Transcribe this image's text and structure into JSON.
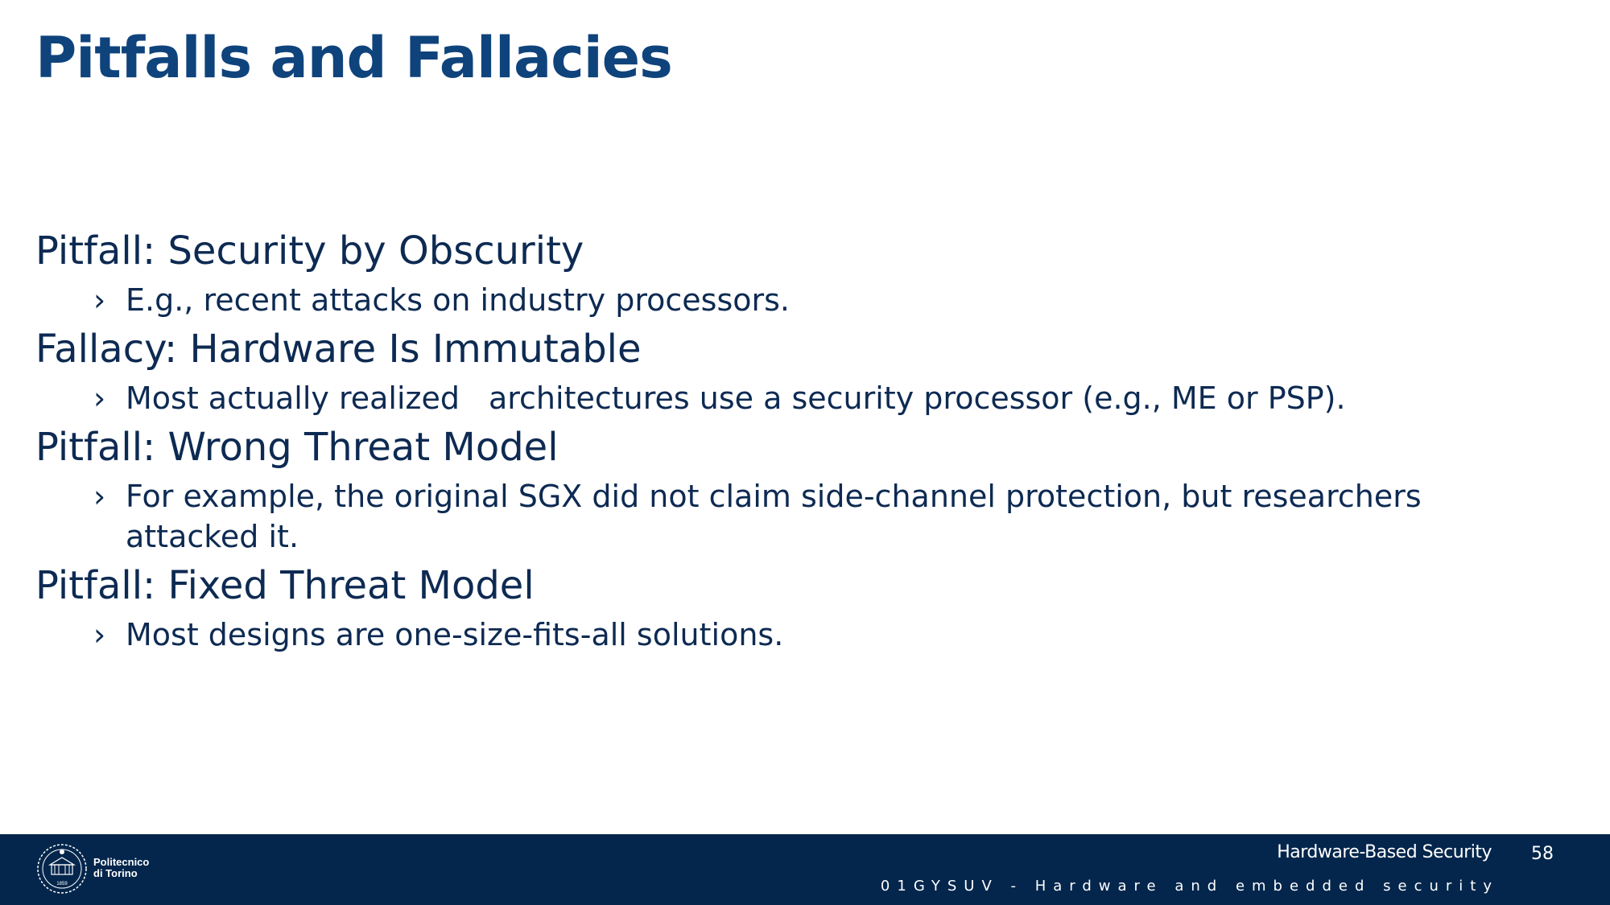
{
  "title": "Pitfalls and Fallacies",
  "items": [
    {
      "heading": "Pitfall: Security by Obscurity",
      "sub": "E.g., recent attacks on industry processors."
    },
    {
      "heading": "Fallacy: Hardware Is Immutable",
      "sub_a": "Most actually realized",
      "sub_b": "architectures use a security processor (e.g., ME or PSP)."
    },
    {
      "heading": "Pitfall: Wrong Threat Model",
      "sub": "For example, the original SGX did not claim side-channel protection, but researchers attacked it."
    },
    {
      "heading": "Pitfall: Fixed Threat Model",
      "sub": "Most designs are one-size-fits-all solutions."
    }
  ],
  "bullet_glyph": "›",
  "footer": {
    "logo_line1": "Politecnico",
    "logo_line2": "di Torino",
    "logo_year": "1859",
    "course_name": "Hardware-Based Security",
    "page_number": "58",
    "course_code": "01GYSUV - Hardware and embedded security",
    "background_color": "#04264c"
  },
  "colors": {
    "title": "#0f437c",
    "body_text": "#0d2a52"
  }
}
